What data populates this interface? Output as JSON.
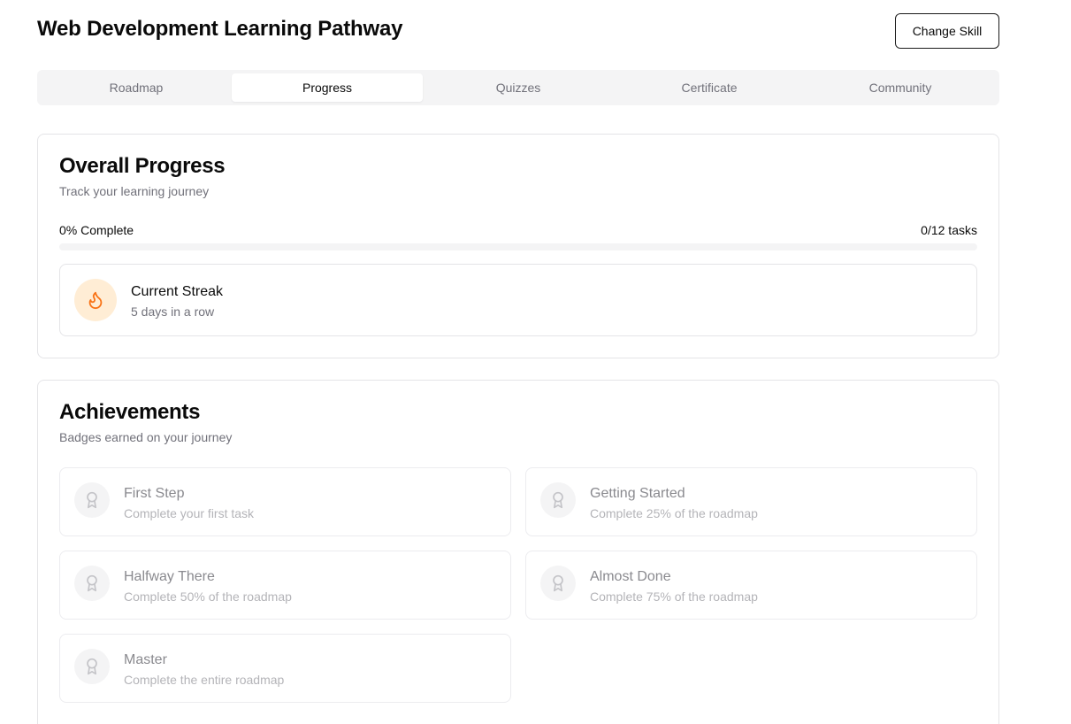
{
  "header": {
    "title": "Web Development Learning Pathway",
    "change_skill_label": "Change Skill"
  },
  "tabs": [
    {
      "label": "Roadmap",
      "active": false
    },
    {
      "label": "Progress",
      "active": true
    },
    {
      "label": "Quizzes",
      "active": false
    },
    {
      "label": "Certificate",
      "active": false
    },
    {
      "label": "Community",
      "active": false
    }
  ],
  "progress": {
    "title": "Overall Progress",
    "subtitle": "Track your learning journey",
    "complete_label": "0% Complete",
    "tasks_label": "0/12 tasks",
    "percent": 0,
    "streak": {
      "icon": "flame-icon",
      "title": "Current Streak",
      "subtitle": "5 days in a row"
    }
  },
  "achievements": {
    "title": "Achievements",
    "subtitle": "Badges earned on your journey",
    "badges": [
      {
        "icon": "award-icon",
        "title": "First Step",
        "description": "Complete your first task"
      },
      {
        "icon": "award-icon",
        "title": "Getting Started",
        "description": "Complete 25% of the roadmap"
      },
      {
        "icon": "award-icon",
        "title": "Halfway There",
        "description": "Complete 50% of the roadmap"
      },
      {
        "icon": "award-icon",
        "title": "Almost Done",
        "description": "Complete 75% of the roadmap"
      },
      {
        "icon": "award-icon",
        "title": "Master",
        "description": "Complete the entire roadmap"
      }
    ]
  },
  "colors": {
    "accent_orange": "#f97316",
    "streak_bg": "#ffedd5",
    "muted_text": "#71717a"
  }
}
